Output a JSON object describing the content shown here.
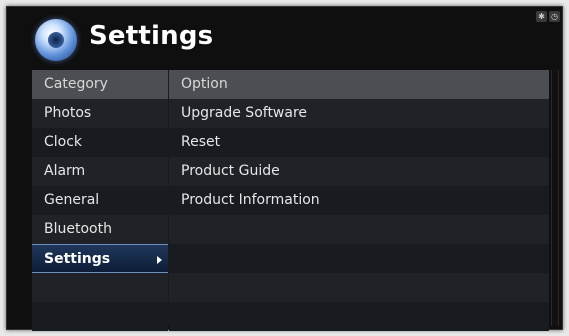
{
  "app": {
    "title": "Settings"
  },
  "menu": {
    "category_header": "Category",
    "option_header": "Option",
    "categories": [
      {
        "label": "Photos"
      },
      {
        "label": "Clock"
      },
      {
        "label": "Alarm"
      },
      {
        "label": "General"
      },
      {
        "label": "Bluetooth"
      },
      {
        "label": "Settings",
        "selected": true
      }
    ],
    "options": [
      {
        "label": "Upgrade Software"
      },
      {
        "label": "Reset"
      },
      {
        "label": "Product Guide"
      },
      {
        "label": "Product Information"
      }
    ]
  },
  "status": {
    "bluetooth_glyph": "✱",
    "clock_glyph": "◷"
  },
  "colors": {
    "selection": "#0d1d38",
    "header": "#4b4f53",
    "background": "#0f0f0f"
  }
}
